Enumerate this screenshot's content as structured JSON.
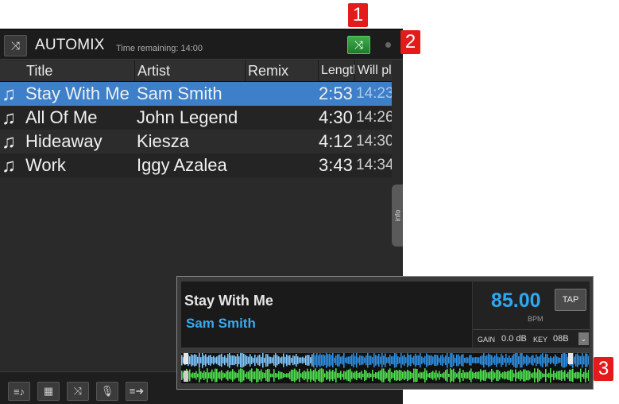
{
  "header": {
    "title": "AUTOMIX",
    "time_remaining": "Time remaining: 14:00"
  },
  "columns": [
    "Title",
    "Artist",
    "Remix",
    "Length",
    "Will play"
  ],
  "rows": [
    {
      "title": "Stay With Me",
      "artist": "Sam Smith",
      "remix": "",
      "length": "2:53",
      "will_play": "14:23",
      "selected": true
    },
    {
      "title": "All Of Me",
      "artist": "John Legend",
      "remix": "",
      "length": "4:30",
      "will_play": "14:26",
      "selected": false
    },
    {
      "title": "Hideaway",
      "artist": "Kiesza",
      "remix": "",
      "length": "4:12",
      "will_play": "14:30",
      "selected": false
    },
    {
      "title": "Work",
      "artist": "Iggy Azalea",
      "remix": "",
      "length": "3:43",
      "will_play": "14:34",
      "selected": false
    }
  ],
  "side_tab": "info",
  "deck": {
    "title": "Stay With Me",
    "artist": "Sam Smith",
    "bpm": "85.00",
    "bpm_label": "BPM",
    "tap_label": "TAP",
    "gain_label": "GAIN",
    "gain_value": "0.0 dB",
    "key_label": "KEY",
    "key_value": "08B"
  },
  "callouts": [
    "1",
    "2",
    "3"
  ],
  "colors": {
    "accent": "#2ea8f2",
    "selected_row": "#3d7fc8",
    "automix_on": "#2e9a3a",
    "callout": "#e41b1b"
  },
  "icons": {
    "shuffle": "⤨",
    "note": "♫",
    "chevron": "⌄"
  }
}
